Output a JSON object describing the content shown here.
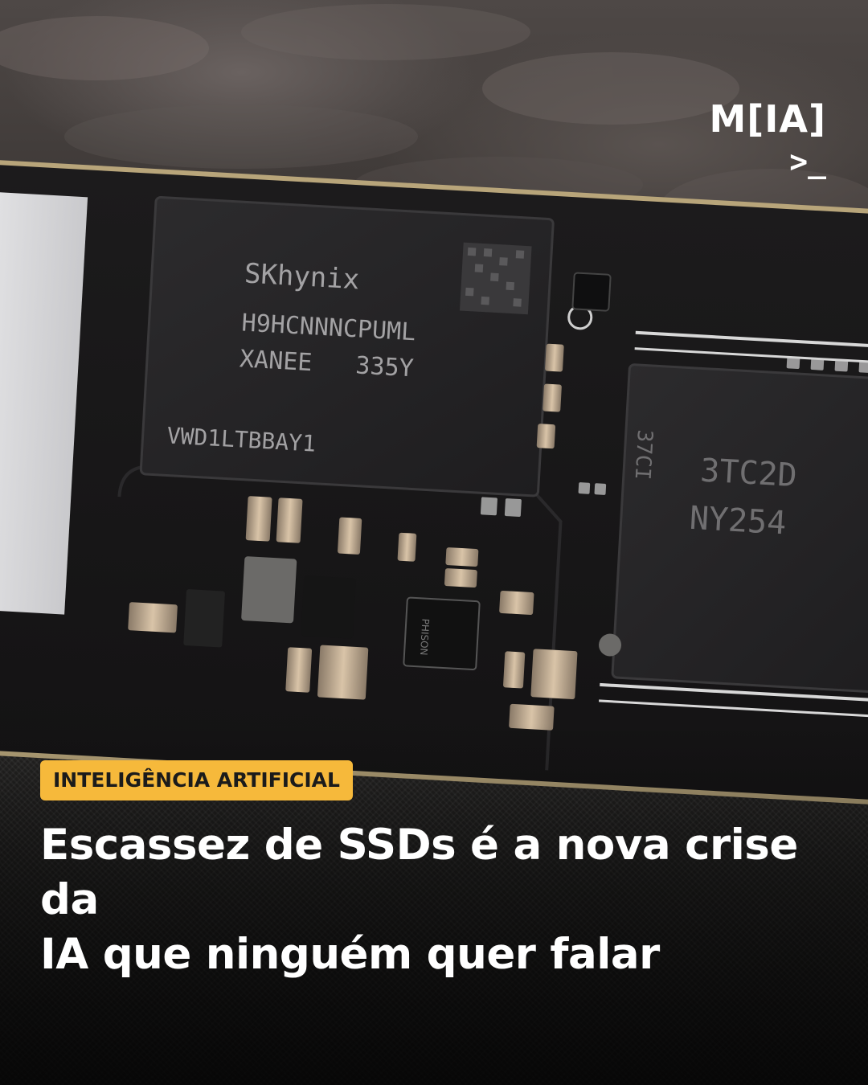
{
  "brand": {
    "logo_text": "M[IA]",
    "prompt_symbol": ">_"
  },
  "category": {
    "label": "INTELIGÊNCIA ARTIFICIAL",
    "color": "#f6b93b"
  },
  "headline": {
    "line1": "Escassez de SSDs é a nova crise da",
    "line2": "IA que ninguém quer falar"
  },
  "photo": {
    "chip1": {
      "line1": "SKhynix",
      "line2": "H9HCNNNCPUML",
      "line3": "XANEE   335Y",
      "line4": "VWD1LTBBAY1"
    },
    "chip2": {
      "line1": "37CI",
      "line2": "3TC2D",
      "line3": "NY254"
    },
    "controller": {
      "label": "PHISON"
    }
  }
}
